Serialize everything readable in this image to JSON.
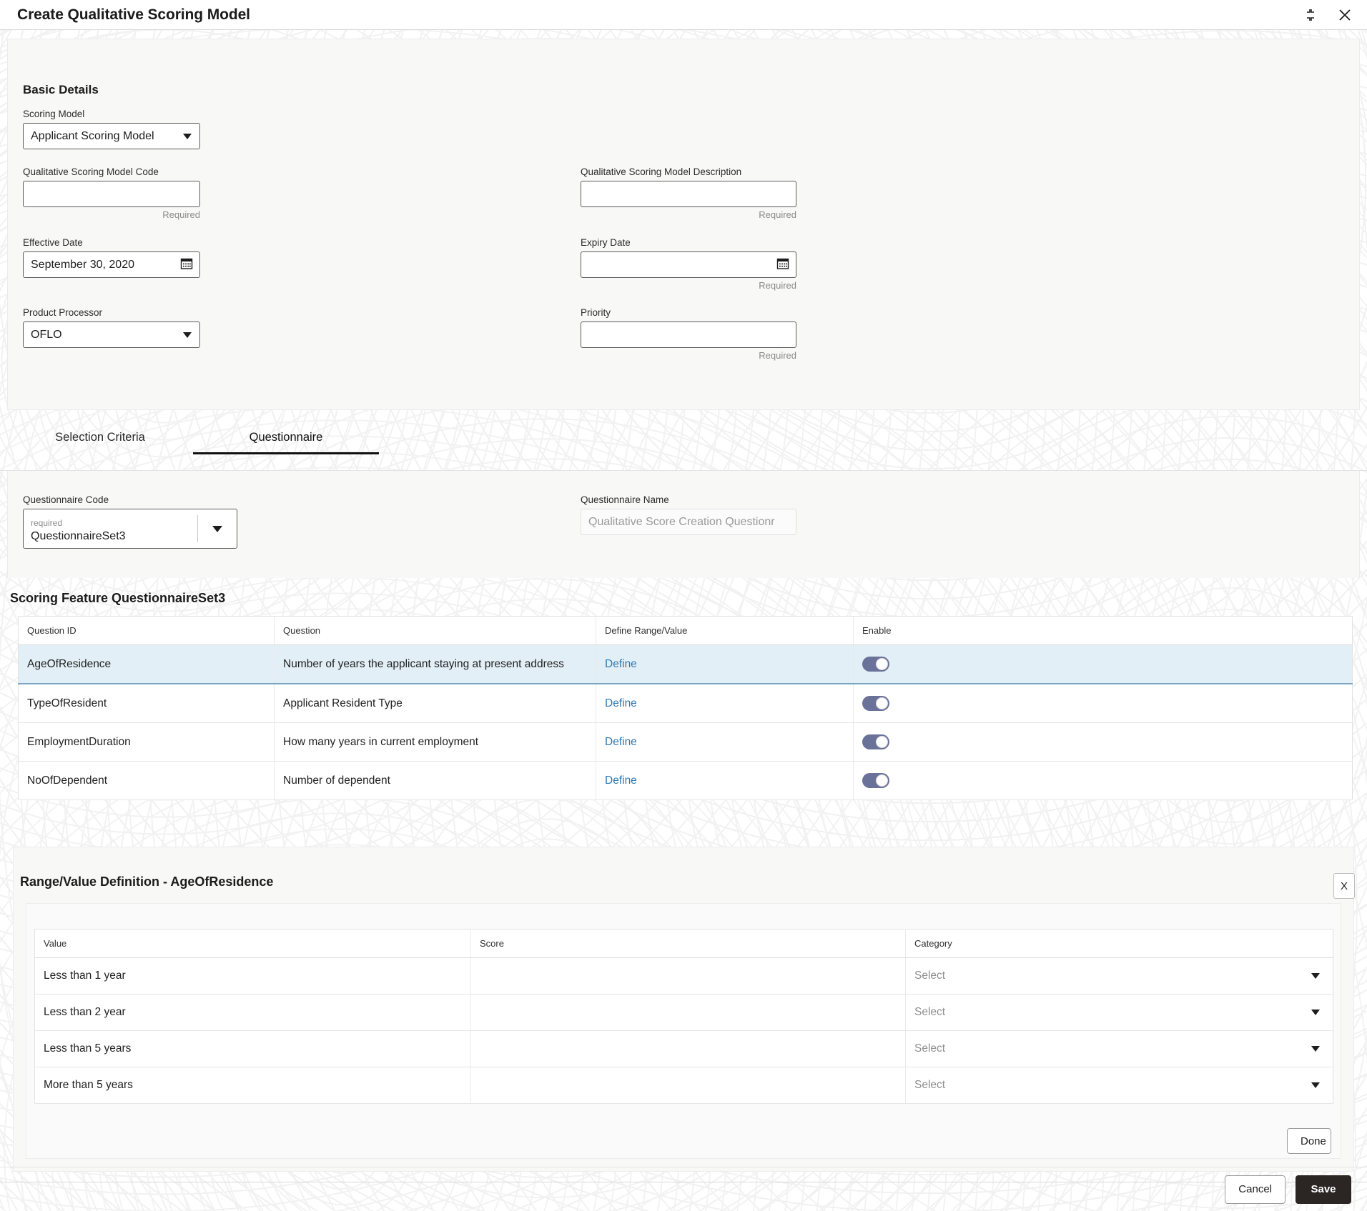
{
  "window": {
    "title": "Create Qualitative Scoring Model",
    "minimize_icon": "collapse-icon",
    "close_icon": "close-icon"
  },
  "basic_details": {
    "heading": "Basic Details",
    "fields": {
      "scoring_model": {
        "label": "Scoring Model",
        "value": "Applicant Scoring Model"
      },
      "model_code": {
        "label": "Qualitative Scoring Model Code",
        "value": "",
        "helper": "Required"
      },
      "model_description": {
        "label": "Qualitative Scoring Model Description",
        "value": "",
        "helper": "Required"
      },
      "effective_date": {
        "label": "Effective Date",
        "value": "September 30, 2020"
      },
      "expiry_date": {
        "label": "Expiry Date",
        "value": "",
        "helper": "Required"
      },
      "product_processor": {
        "label": "Product Processor",
        "value": "OFLO"
      },
      "priority": {
        "label": "Priority",
        "value": "",
        "helper": "Required"
      }
    }
  },
  "tabs": [
    {
      "label": "Selection Criteria",
      "active": false
    },
    {
      "label": "Questionnaire",
      "active": true
    }
  ],
  "questionnaire": {
    "code": {
      "label": "Questionnaire Code",
      "hint": "required",
      "value": "QuestionnaireSet3"
    },
    "name": {
      "label": "Questionnaire Name",
      "placeholder": "Qualitative Score Creation Questionr",
      "value": ""
    }
  },
  "scoring_feature": {
    "heading": "Scoring Feature QuestionnaireSet3",
    "columns": [
      "Question ID",
      "Question",
      "Define Range/Value",
      "Enable"
    ],
    "rows": [
      {
        "question_id": "AgeOfResidence",
        "question": "Number of years the applicant staying at present address",
        "define": "Define",
        "enabled": true,
        "selected": true
      },
      {
        "question_id": "TypeOfResident",
        "question": "Applicant Resident Type",
        "define": "Define",
        "enabled": true,
        "selected": false
      },
      {
        "question_id": "EmploymentDuration",
        "question": "How many years in current employment",
        "define": "Define",
        "enabled": true,
        "selected": false
      },
      {
        "question_id": "NoOfDependent",
        "question": "Number of dependent",
        "define": "Define",
        "enabled": true,
        "selected": false
      }
    ]
  },
  "range_value": {
    "heading": "Range/Value Definition - AgeOfResidence",
    "close_label": "X",
    "columns": [
      "Value",
      "Score",
      "Category"
    ],
    "rows": [
      {
        "value": "Less than 1 year",
        "score": "",
        "category": "Select"
      },
      {
        "value": "Less than 2 year",
        "score": "",
        "category": "Select"
      },
      {
        "value": "Less than 5 years",
        "score": "",
        "category": "Select"
      },
      {
        "value": "More than 5 years",
        "score": "",
        "category": "Select"
      }
    ],
    "done_label": "Done"
  },
  "footer": {
    "cancel_label": "Cancel",
    "save_label": "Save"
  },
  "colors": {
    "accent_link": "#2e78b3",
    "row_selected": "#e2eff6",
    "toggle_on": "#6a7299",
    "save_button": "#2b2523"
  }
}
